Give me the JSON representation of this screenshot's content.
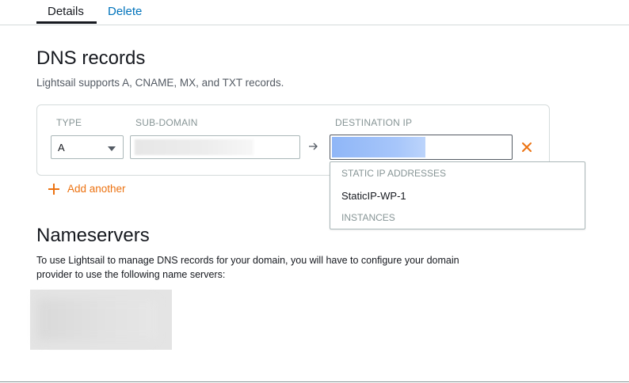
{
  "tabs": {
    "details": "Details",
    "delete": "Delete"
  },
  "dns": {
    "title": "DNS records",
    "subtitle": "Lightsail supports A, CNAME, MX, and TXT records.",
    "columns": {
      "type": "TYPE",
      "subdomain": "SUB-DOMAIN",
      "destination": "DESTINATION IP"
    },
    "record": {
      "type_value": "A"
    },
    "add_another_label": "Add another",
    "dropdown": {
      "group_static": "STATIC IP ADDRESSES",
      "option_static_ip": "StaticIP-WP-1",
      "group_instances": "INSTANCES"
    }
  },
  "nameservers": {
    "title": "Nameservers",
    "description": "To use Lightsail to manage DNS records for your domain, you will have to configure your domain provider to use the following name servers:"
  },
  "colors": {
    "accent": "#ec7211",
    "link": "#0073bb",
    "text": "#16191f"
  },
  "icons": [
    "arrow-right-icon",
    "close-icon",
    "plus-icon",
    "chevron-down-icon"
  ]
}
